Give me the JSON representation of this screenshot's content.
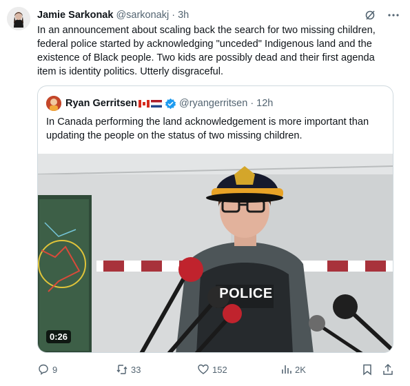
{
  "post": {
    "author_name": "Jamie Sarkonak",
    "handle": "@sarkonakj",
    "separator": "·",
    "time": "3h",
    "text": "In an announcement about scaling back the search for two missing children, federal police started by acknowledging \"unceded\" Indigenous land and the existence of Black people. Two kids are possibly dead and their first agenda item is identity politics. Utterly disgraceful.",
    "icons": {
      "grok": "grok-slash-icon",
      "more": "more-dots-icon"
    }
  },
  "quote": {
    "author_name": "Ryan Gerritsen",
    "flags": [
      "canada-flag-icon",
      "netherlands-flag-icon"
    ],
    "verified_icon": "verified-badge-icon",
    "verified_color": "#1d9bf0",
    "handle": "@ryangerritsen",
    "separator": "·",
    "time": "12h",
    "text": "In Canada performing the land acknowledgement is more important than updating the people on the status of two missing children.",
    "video": {
      "duration": "0:26",
      "vest_text": "POLICE"
    }
  },
  "actions": {
    "replies": "9",
    "reposts": "33",
    "likes": "152",
    "views": "2K"
  },
  "colors": {
    "text": "#0f1419",
    "muted": "#536471",
    "border": "#cfd9de"
  }
}
